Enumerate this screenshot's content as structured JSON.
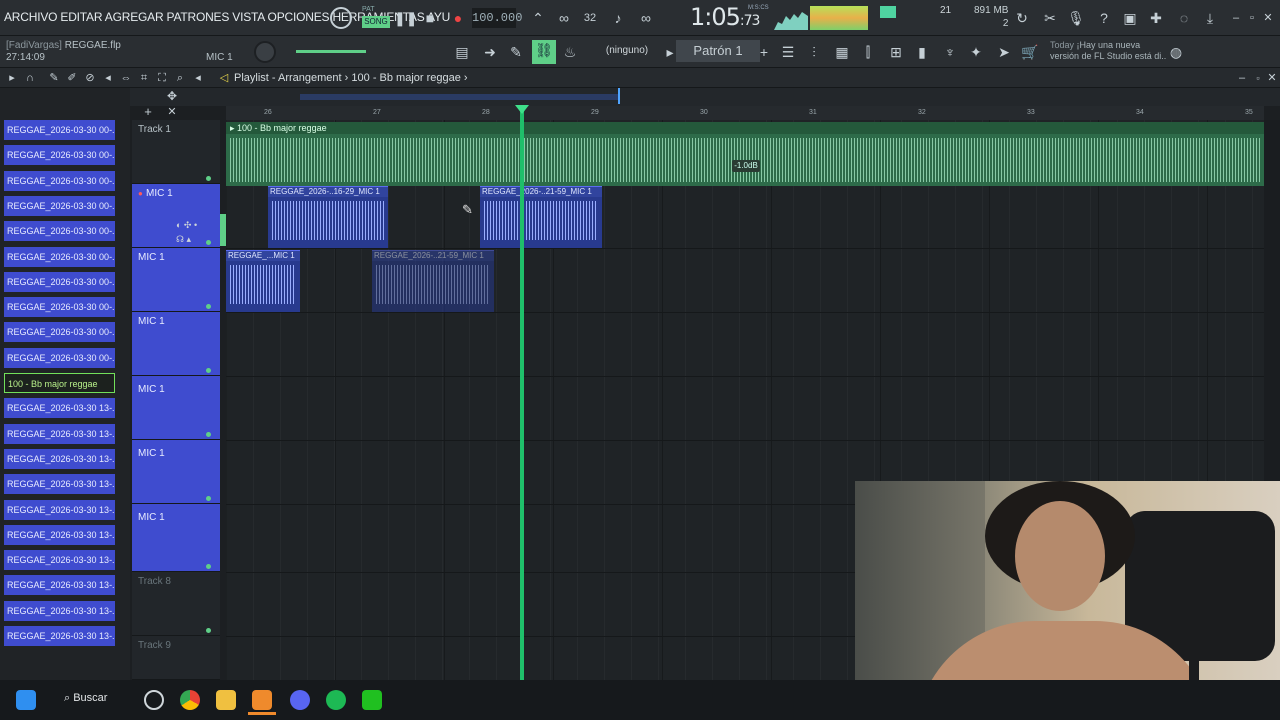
{
  "menu": {
    "items": "ARCHIVO EDITAR AGREGAR PATRONES VISTA OPCIONES HERRAMIENTAS AYU"
  },
  "transport": {
    "pat": "PAT",
    "song": "SONG",
    "tempo": "100.000",
    "time_main": "1:05",
    "time_sub": "73",
    "mcs": "M:S:CS"
  },
  "status": {
    "cpu_num": "21",
    "ram": "891 MB",
    "ram2": "2"
  },
  "project": {
    "user": "[FadiVargas]",
    "file": "REGGAE.flp",
    "elapsed": "27:14:09"
  },
  "mixer_insert": "MIC 1",
  "snap": "(ninguno)",
  "pattern": "Patrón 1",
  "hint": {
    "today": "Today",
    "text1": "¡Hay una nueva",
    "text2": "versión de FL Studio está di.."
  },
  "playlist": {
    "title": "Playlist - Arrangement",
    "arrow": "›",
    "pattern": "100 - Bb major reggae"
  },
  "browser": {
    "items": [
      "REGGAE_2026-03-30 00-...",
      "REGGAE_2026-03-30 00-...",
      "REGGAE_2026-03-30 00-...",
      "REGGAE_2026-03-30 00-...",
      "REGGAE_2026-03-30 00-...",
      "REGGAE_2026-03-30 00-...",
      "REGGAE_2026-03-30 00-...",
      "REGGAE_2026-03-30 00-...",
      "REGGAE_2026-03-30 00-...",
      "REGGAE_2026-03-30 00-...",
      "100 - Bb major reggae",
      "REGGAE_2026-03-30 13-...",
      "REGGAE_2026-03-30 13-...",
      "REGGAE_2026-03-30 13-...",
      "REGGAE_2026-03-30 13-...",
      "REGGAE_2026-03-30 13-...",
      "REGGAE_2026-03-30 13-...",
      "REGGAE_2026-03-30 13-...",
      "REGGAE_2026-03-30 13-...",
      "REGGAE_2026-03-30 13-...",
      "REGGAE_2026-03-30 13-..."
    ]
  },
  "tracks": {
    "t1": "Track 1",
    "t2": "MIC 1",
    "t3": "MIC 1",
    "t4": "MIC 1",
    "t5": "MIC 1",
    "t6": "MIC 1",
    "t7": "MIC 1",
    "t8": "Track 8",
    "t9": "Track 9"
  },
  "ruler": [
    "26",
    "27",
    "28",
    "29",
    "30",
    "31",
    "32",
    "33",
    "34",
    "35"
  ],
  "clips": {
    "pattern": "100 - Bb major reggae",
    "c1": "REGGAE_2026-..16-29_MIC 1",
    "c2": "REGGAE_2026-..21-59_MIC 1",
    "c3": "REGGAE_...MIC 1",
    "c4": "REGGAE_2026-..21-59_MIC 1",
    "db": "-1.0dB"
  },
  "taskbar": {
    "search": "Buscar"
  },
  "colors": {
    "clip_blue": "#3f4ccf",
    "pattern_green": "#2d6b49",
    "playhead": "#1fbf6a"
  }
}
